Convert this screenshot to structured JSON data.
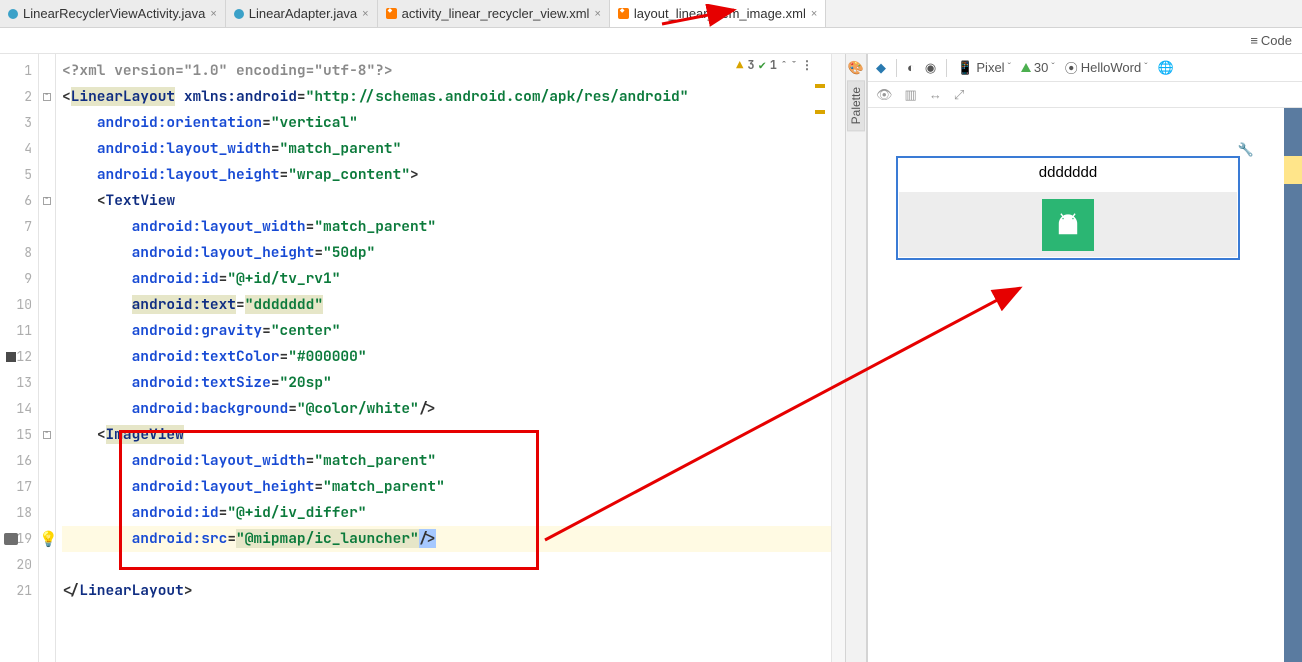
{
  "tabs": [
    {
      "label": "LinearRecyclerViewActivity.java",
      "kind": "java"
    },
    {
      "label": "LinearAdapter.java",
      "kind": "java"
    },
    {
      "label": "activity_linear_recycler_view.xml",
      "kind": "xml"
    },
    {
      "label": "layout_linear_item_image.xml",
      "kind": "xml",
      "active": true
    }
  ],
  "code_view_label": "Code",
  "inspection": {
    "warn_count": "3",
    "check_count": "1"
  },
  "lines": {
    "l1": "<?xml version=\"1.0\" encoding=\"utf-8\"?>",
    "open_tag": "LinearLayout",
    "xmlns_key": "xmlns:android",
    "xmlns_val": "\"http://schemas.android.com/apk/res/android\"",
    "orient_key": "android:orientation",
    "orient_val": "\"vertical\"",
    "lw_key": "android:layout_width",
    "lw_val": "\"match_parent\"",
    "lh_key": "android:layout_height",
    "lh_val": "\"wrap_content\"",
    "lh_close": ">",
    "tv_open": "TextView",
    "tv_lw_val": "\"match_parent\"",
    "tv_lh_val": "\"50dp\"",
    "id_key": "android:id",
    "tv_id_val": "\"@+id/tv_rv1\"",
    "text_key": "android:text",
    "text_val": "\"ddddddd\"",
    "grav_key": "android:gravity",
    "grav_val": "\"center\"",
    "tc_key": "android:textColor",
    "tc_val": "\"#000000\"",
    "ts_key": "android:textSize",
    "ts_val": "\"20sp\"",
    "bg_key": "android:background",
    "bg_val": "\"@color/white\"",
    "bg_close": "/>",
    "iv_open": "ImageView",
    "iv_lw_val": "\"match_parent\"",
    "iv_lh_val": "\"match_parent\"",
    "iv_id_val": "\"@+id/iv_differ\"",
    "src_key": "android:src",
    "src_val": "\"@mipmap/ic_launcher\"",
    "src_close": "/>",
    "close_tag": "LinearLayout"
  },
  "line_numbers": [
    "1",
    "2",
    "3",
    "4",
    "5",
    "6",
    "7",
    "8",
    "9",
    "10",
    "11",
    "12",
    "13",
    "14",
    "15",
    "16",
    "17",
    "18",
    "19",
    "20",
    "21"
  ],
  "palette_label": "Palette",
  "preview_toolbar": {
    "device": "Pixel",
    "api": "30",
    "theme": "HelloWord"
  },
  "preview_text": "ddddddd"
}
